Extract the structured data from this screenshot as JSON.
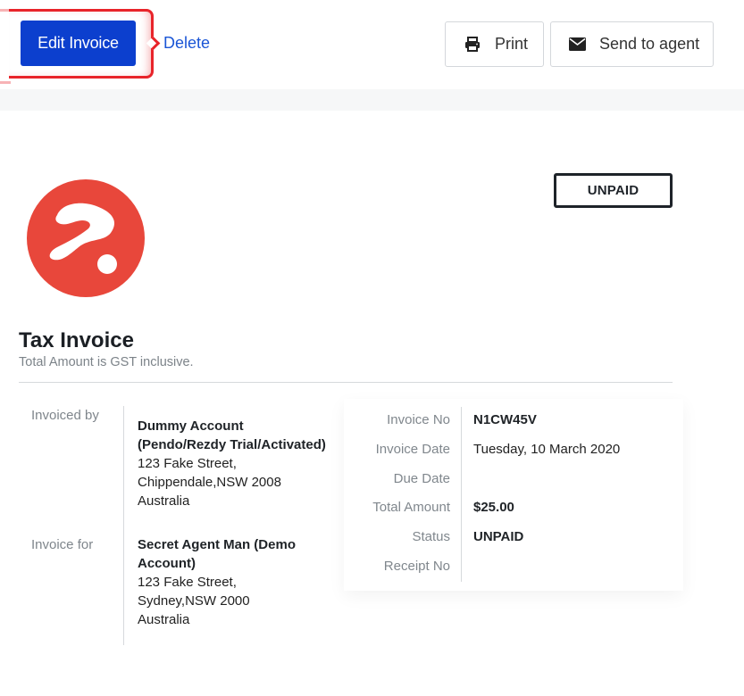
{
  "toolbar": {
    "edit_label": "Edit Invoice",
    "delete_label": "Delete",
    "print_label": "Print",
    "send_label": "Send to agent",
    "print_icon": "printer-icon",
    "send_icon": "envelope-icon"
  },
  "colors": {
    "primary": "#0c3fce",
    "link": "#1a55d6",
    "logo": "#e8473b",
    "highlight": "#e8242a"
  },
  "invoice": {
    "status": "UNPAID",
    "title": "Tax Invoice",
    "subtitle": "Total Amount is GST inclusive.",
    "invoiced_by": {
      "label": "Invoiced by",
      "name_line1": "Dummy Account",
      "name_line2": "(Pendo/Rezdy Trial/Activated)",
      "address_line1": "123 Fake Street,",
      "address_line2": "Chippendale,NSW 2008",
      "country": "Australia"
    },
    "invoice_for": {
      "label": "Invoice for",
      "name_line1": "Secret Agent Man (Demo",
      "name_line2": "Account)",
      "address_line1": "123 Fake Street,",
      "address_line2": "Sydney,NSW 2000",
      "country": "Australia"
    },
    "meta": {
      "invoice_no_label": "Invoice No",
      "invoice_no": "N1CW45V",
      "invoice_date_label": "Invoice Date",
      "invoice_date": "Tuesday, 10 March 2020",
      "due_date_label": "Due Date",
      "due_date": "",
      "total_label": "Total Amount",
      "total": "$25.00",
      "status_label": "Status",
      "status": "UNPAID",
      "receipt_label": "Receipt No",
      "receipt": ""
    }
  }
}
